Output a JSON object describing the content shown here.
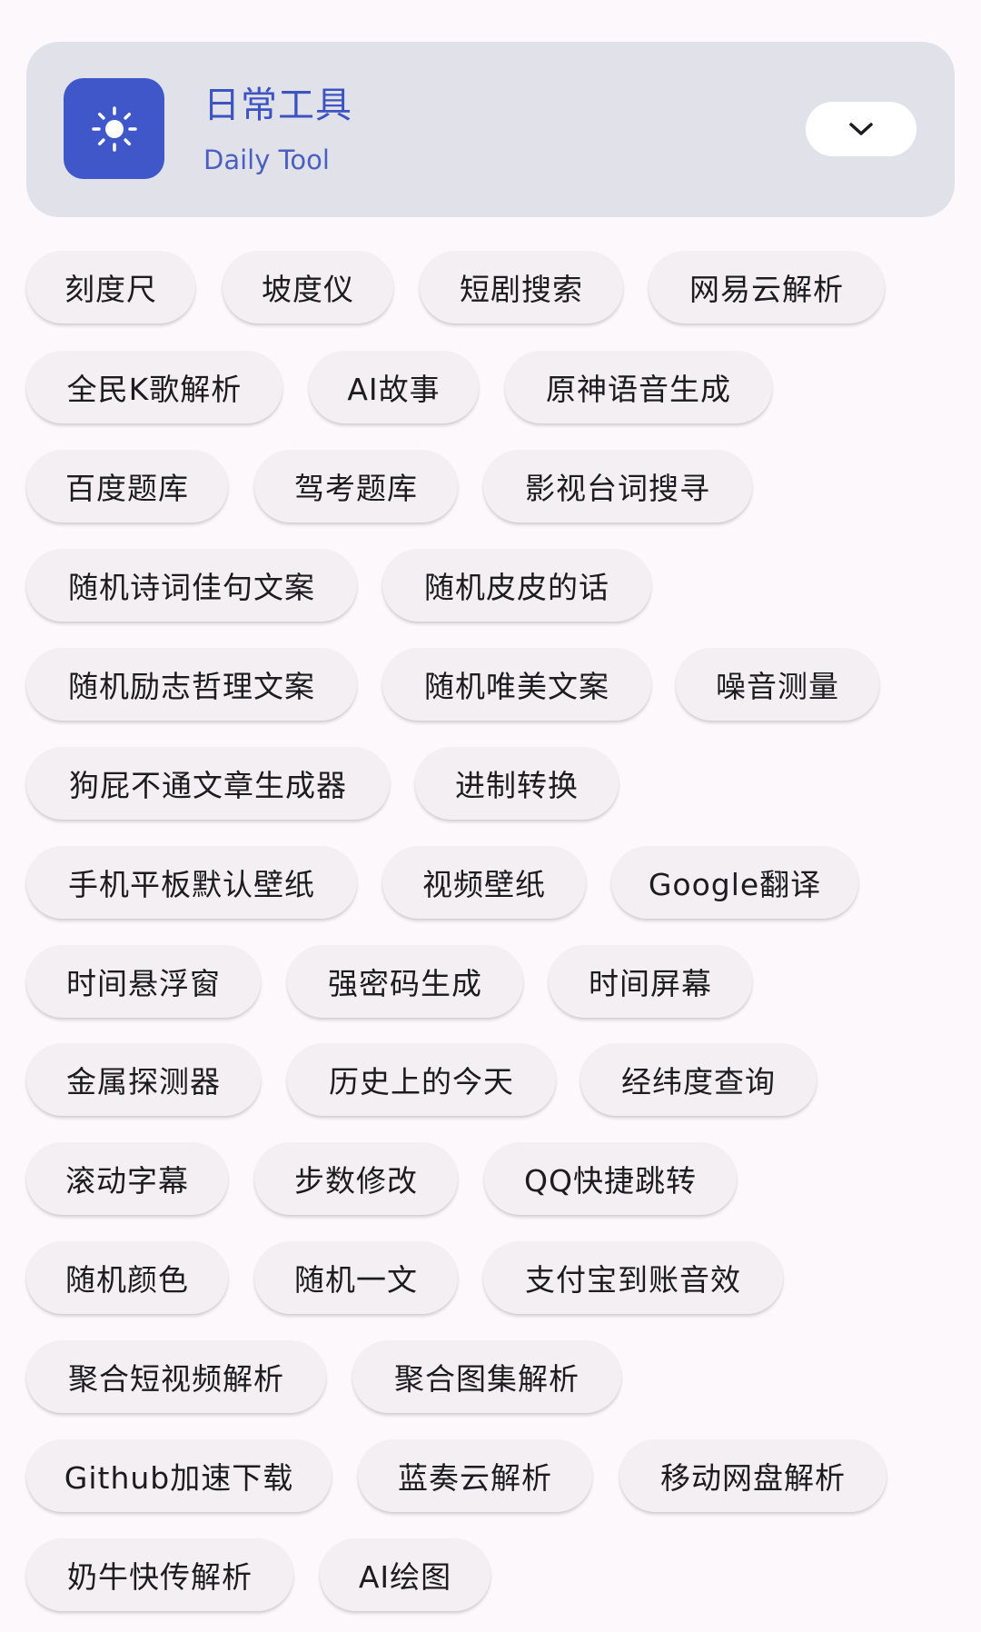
{
  "header": {
    "title": "日常工具",
    "subtitle": "Daily Tool",
    "icon": "sun-icon",
    "expand_icon": "chevron-down-icon",
    "accent_color": "#3f57c8",
    "background_color": "#e1e2e9"
  },
  "tools": [
    "刻度尺",
    "坡度仪",
    "短剧搜索",
    "网易云解析",
    "全民K歌解析",
    "AI故事",
    "原神语音生成",
    "百度题库",
    "驾考题库",
    "影视台词搜寻",
    "随机诗词佳句文案",
    "随机皮皮的话",
    "随机励志哲理文案",
    "随机唯美文案",
    "噪音测量",
    "狗屁不通文章生成器",
    "进制转换",
    "手机平板默认壁纸",
    "视频壁纸",
    "Google翻译",
    "时间悬浮窗",
    "强密码生成",
    "时间屏幕",
    "金属探测器",
    "历史上的今天",
    "经纬度查询",
    "滚动字幕",
    "步数修改",
    "QQ快捷跳转",
    "随机颜色",
    "随机一文",
    "支付宝到账音效",
    "聚合短视频解析",
    "聚合图集解析",
    "Github加速下载",
    "蓝奏云解析",
    "移动网盘解析",
    "奶牛快传解析",
    "AI绘图"
  ]
}
